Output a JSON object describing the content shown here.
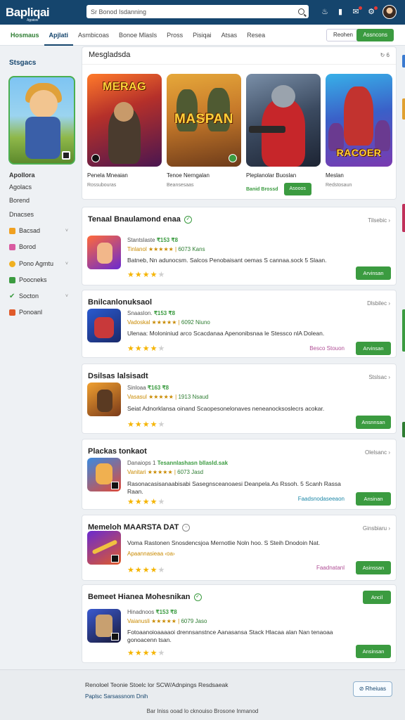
{
  "header": {
    "logo": "Bapliqai",
    "logo_sub": "Appstore",
    "search_placeholder": "Sr Bonod Isdanning",
    "icons": [
      "flame-icon",
      "bookmark-icon",
      "notification-icon",
      "settings-icon"
    ],
    "colors": {
      "bar": "#15456d",
      "accent": "#3b9b40"
    }
  },
  "nav": {
    "tabs": [
      "Hosmaus",
      "Apjlati",
      "Asmbicoas",
      "Bonoe Mlasls",
      "Pross",
      "Pisiqai",
      "Atsas",
      "Resea"
    ],
    "active_index": 1,
    "outline_button": "Reohen",
    "green_button": "Assncons"
  },
  "sidebar": {
    "title": "Stsgacs",
    "feature_label": "Apollora",
    "items": [
      {
        "label": "Agolacs",
        "icon": "",
        "chevron": false
      },
      {
        "label": "Borend",
        "icon": "",
        "chevron": false
      },
      {
        "label": "Dnacses",
        "icon": "",
        "chevron": false
      },
      {
        "label": "Bacsad",
        "icon": "star-icon",
        "chevron": true
      },
      {
        "label": "Borod",
        "icon": "puzzle-icon",
        "chevron": false
      },
      {
        "label": "Pono Agmtu",
        "icon": "coin-icon",
        "chevron": true
      },
      {
        "label": "Poocneks",
        "icon": "grid-icon",
        "chevron": false
      },
      {
        "label": "Socton",
        "icon": "check-icon",
        "chevron": true
      },
      {
        "label": "Ponoanl",
        "icon": "flag-icon",
        "chevron": false
      }
    ]
  },
  "featured": {
    "title": "Mesgladsda",
    "control": "↻ 6",
    "games": [
      {
        "art_title": "MERAG",
        "name": "Penela Mneaian",
        "meta": "Rossubouras",
        "price": "",
        "button": ""
      },
      {
        "art_title": "MASPAN",
        "name": "Tenoe Nerngalan",
        "meta": "Beansesaas",
        "price": "",
        "button": ""
      },
      {
        "art_title": "",
        "name": "Pleplanolar Buoslan",
        "meta": "",
        "price": "Banid Brossd",
        "button": "Asooos"
      },
      {
        "art_title": "RACOER",
        "name": "Meslan",
        "meta": "Redstosaun",
        "price": "",
        "button": ""
      }
    ]
  },
  "list": [
    {
      "title": "Tenaal Bnaulamond enaa",
      "verified": true,
      "control": "Tilsebic ›",
      "line1": "Stantslaste ",
      "line1_hl": "₹153 ₹8",
      "line2": "Tinlanol ★★★★★ | ",
      "line2_rt": "6073 Kans",
      "desc": "Batneb, Nn adunocsm. Salcos Penobaisant oemas S cannaa.sock 5 Slaan.",
      "rating": 4,
      "link": "",
      "button": "Arvinsan"
    },
    {
      "title": "Bnilcanlonuksaol",
      "verified": false,
      "control": "Dlsbilec ›",
      "line1": "Snaaslon. ",
      "line1_hl": "₹153 ₹8",
      "line2": "Vadoskal ★★★★★ | ",
      "line2_rt": "6092 Niuno",
      "desc": "Ulenaa: Moloniniud arco Scacdanaa Apenonibsnaa le Stessco nlA Dolean.",
      "rating": 4,
      "link": "Besco Stouon",
      "button": "Arvinsan"
    },
    {
      "title": "Dsilsas lalsisadt",
      "verified": false,
      "control": "Stslsac ›",
      "line1": "Sinloaa ",
      "line1_hl": "₹163 ₹8",
      "line2": "Vasasul ★★★★★ | ",
      "line2_rt": "1913 Nsaud",
      "desc": "Seiat Adnorklansa oinand Scaopesonelonaves neneanocksoslecrs acokar.",
      "rating": 4,
      "link": "",
      "button": "Ansnnsan"
    },
    {
      "title": "Plackas tonkaot",
      "verified": false,
      "control": "Olelsanc ›",
      "line1": "Danaiops 1 ",
      "line1_hl": "Tesannlashasn bllasld.sak",
      "line2": "Vanitari ★★★★★ | ",
      "line2_rt": "6073 Jasd",
      "desc": "Rasonacasisanaabisabi Sasegnsceanoaesi Deanpela.As Rssoh. 5 Scanh Rassa Raan.",
      "rating": 4,
      "link": "Faadsnodaseeaon",
      "button": "Ansinan"
    },
    {
      "title": "Memeloh MAARSTA DAT",
      "verified": false,
      "control": "Ginsbiaru ›",
      "line1": "",
      "line1_hl": "",
      "line2": "",
      "line2_rt": "",
      "desc": "Voma Rastonen Snosdencsjoa Mernotlie Noln hoo. S Steih Dnodoin Nat.",
      "sub": "Apaannasieaa ‹oa›",
      "rating": 4,
      "link": "Faadnatanl",
      "button": "Asinssan"
    },
    {
      "title": "Bemeet Hianea Mohesnikan",
      "verified": true,
      "control": "",
      "line1": "Hinadnoos ",
      "line1_hl": "₹153 ₹8",
      "line2": "Vaianusli ★★★★★ | ",
      "line2_rt": "6079 Jaso",
      "desc": "Fotoaanoioaaaaoi drennsanstnce Aanasansa Stack Hlacaa alan Nan tenaoaa gonoacenn tsan.",
      "rating": 4,
      "link": "",
      "button": "Ansinsan",
      "top_button": "Ancil"
    }
  ],
  "footer": {
    "line1": "Renoloel Teonie Stoelc lor SCW/Adnpings Resdsaeak",
    "line2": "Paplsc Sarsassnom Dnih",
    "line3": "Bar Iniss ooad lo cknouiso Brosone Inmanod",
    "button": "⊘ Rheiuas"
  }
}
